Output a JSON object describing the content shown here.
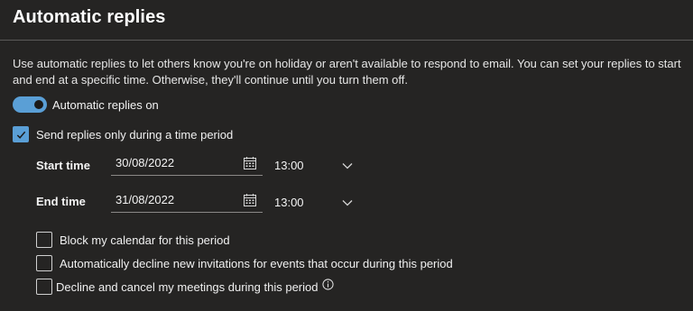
{
  "title": "Automatic replies",
  "description": {
    "line1": "Use automatic replies to let others know you're on holiday or aren't available to respond to email. You can set your replies to start",
    "line2": "and end at a specific time. Otherwise, they'll continue until you turn them off."
  },
  "toggle": {
    "label": "Automatic replies on",
    "on": true
  },
  "time_period": {
    "label": "Send replies only during a time period",
    "checked": true
  },
  "start": {
    "label": "Start time",
    "date": "30/08/2022",
    "time": "13:00"
  },
  "end": {
    "label": "End time",
    "date": "31/08/2022",
    "time": "13:00"
  },
  "options": [
    {
      "label": "Block my calendar for this period",
      "checked": false
    },
    {
      "label": "Automatically decline new invitations for events that occur during this period",
      "checked": false
    },
    {
      "label": "Decline and cancel my meetings during this period",
      "checked": false
    }
  ],
  "colors": {
    "accent": "#5a9fd6",
    "background": "#252423"
  },
  "icons": {
    "calendar": "calendar-icon",
    "chevron": "chevron-down-icon",
    "info": "info-icon",
    "check": "checkmark-icon"
  }
}
